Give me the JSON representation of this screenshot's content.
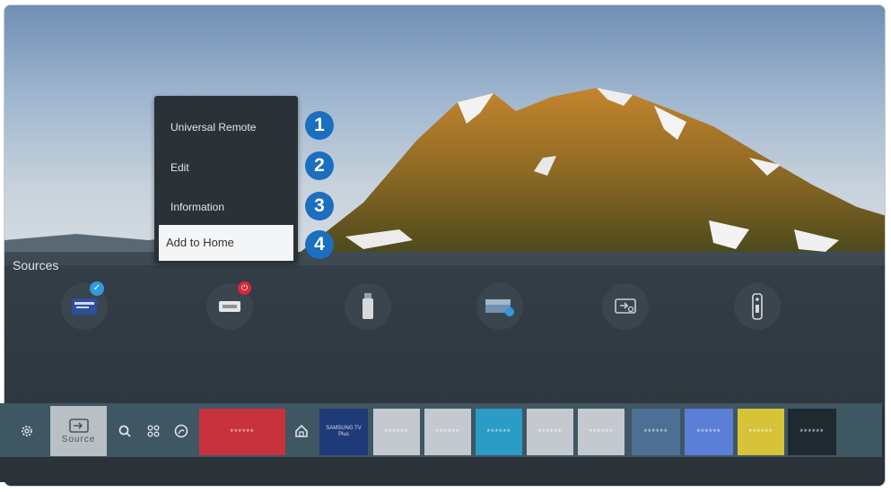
{
  "menu": {
    "items": [
      "Universal Remote",
      "Edit",
      "Information",
      "Add to Home"
    ],
    "selected_index": 3
  },
  "callouts": [
    "1",
    "2",
    "3",
    "4"
  ],
  "sources": {
    "title": "Sources",
    "items": [
      {
        "icon": "samsung-tv-plus-icon",
        "badge": "check"
      },
      {
        "icon": "hdmi-icon",
        "badge": "power"
      },
      {
        "icon": "usb-icon",
        "badge": ""
      },
      {
        "icon": "screen-mirror-icon",
        "badge": ""
      },
      {
        "icon": "connection-guide-icon",
        "badge": ""
      },
      {
        "icon": "remote-icon",
        "badge": ""
      }
    ]
  },
  "bottom_bar": {
    "settings_icon": "gear-icon",
    "source_label": "Source",
    "search_icon": "search-icon",
    "apps_icon": "apps-icon",
    "ambient_icon": "ambient-icon",
    "home_icon": "home-icon",
    "tiles": [
      {
        "text": "******",
        "color": "#c8323c"
      },
      {
        "text": "SAMSUNG TV Plus",
        "color": "#1f3a78"
      },
      {
        "text": "******",
        "color": "#c3c9ce"
      },
      {
        "text": "******",
        "color": "#c3c9ce"
      },
      {
        "text": "******",
        "color": "#2a9cc6"
      },
      {
        "text": "******",
        "color": "#c3c9ce"
      },
      {
        "text": "******",
        "color": "#c3c9ce"
      },
      {
        "text": "******",
        "color": "#4c6f93"
      },
      {
        "text": "******",
        "color": "#5b7ed6"
      },
      {
        "text": "******",
        "color": "#d6c338"
      },
      {
        "text": "******",
        "color": "#1f2a30"
      }
    ]
  }
}
